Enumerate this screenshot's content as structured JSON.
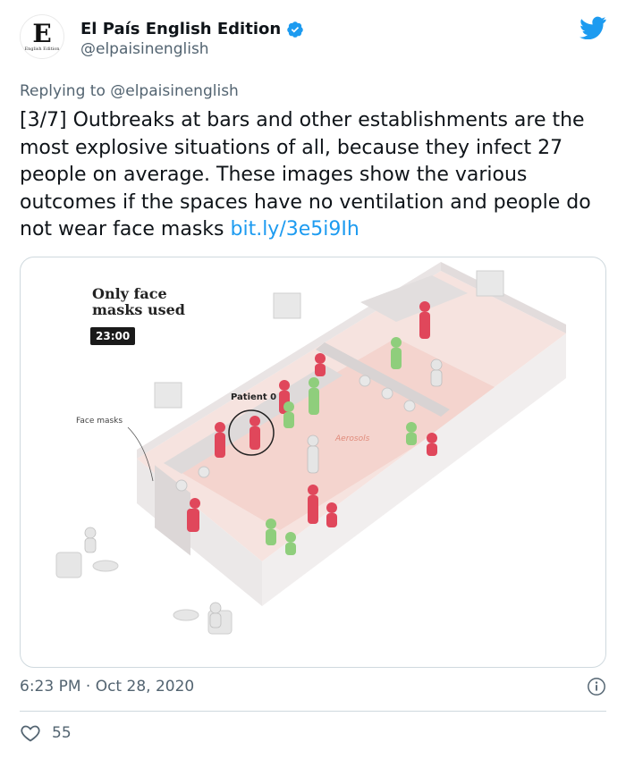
{
  "author": {
    "display_name": "El País English Edition",
    "handle": "@elpaisinenglish",
    "avatar_letter": "E",
    "avatar_caption": "English Edition",
    "verified": true
  },
  "reply": {
    "prefix": "Replying to ",
    "mention": "@elpaisinenglish"
  },
  "tweet": {
    "text": "[3/7] Outbreaks at bars and other establishments are the most explosive situations of all, because they infect 27 people on average. These images show the various outcomes if the spaces have no ventilation and people do not wear face masks ",
    "link": "bit.ly/3e5i9Ih"
  },
  "media": {
    "title": "Only face masks used",
    "time": "23:00",
    "label_face_masks": "Face masks",
    "label_patient": "Patient 0",
    "label_aerosols": "Aerosols"
  },
  "meta": {
    "timestamp": "6:23 PM · Oct 28, 2020"
  },
  "engagement": {
    "likes": "55"
  },
  "colors": {
    "link": "#1d9bf0",
    "secondary_text": "#536471",
    "infected": "#e0475b",
    "masked": "#8fce7c"
  },
  "icons": {
    "verified": "verified-badge-icon",
    "brand": "twitter-bird-icon",
    "info": "info-icon",
    "like": "heart-icon"
  }
}
